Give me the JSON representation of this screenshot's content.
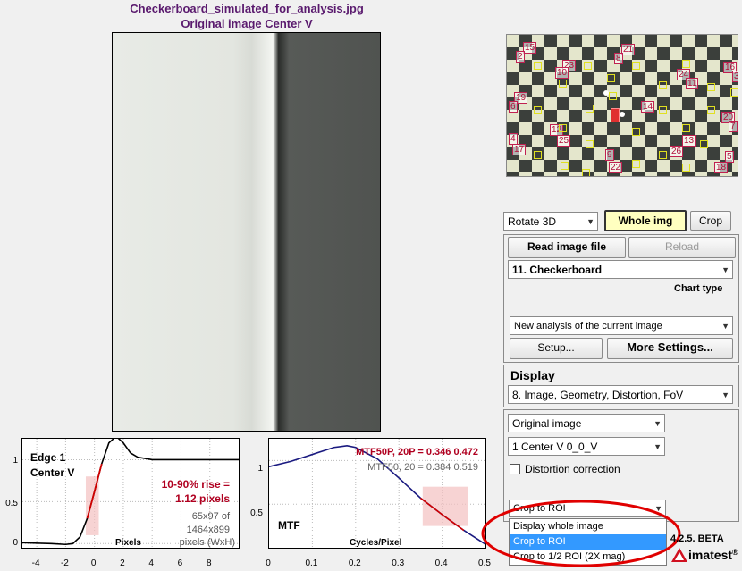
{
  "header": {
    "filename": "Checkerboard_simulated_for_analysis.jpg",
    "subtitle": "Original image   Center  V"
  },
  "edge_plot": {
    "title_line1": "Edge 1",
    "title_line2": "Center  V",
    "rise_label": "10-90% rise =",
    "rise_value": "1.12 pixels",
    "roi_size": "65x97 of",
    "image_size": "1464x899",
    "size_unit": "pixels (WxH)",
    "xlabel": "Pixels",
    "x_ticks": [
      "-4",
      "-2",
      "0",
      "2",
      "4",
      "6",
      "8"
    ],
    "y_ticks": [
      "0",
      "0.5",
      "1"
    ]
  },
  "mtf_plot": {
    "label": "MTF",
    "mtf50p": "MTF50P, 20P = 0.346  0.472",
    "mtf50": "MTF50, 20  =  0.384  0.519",
    "xlabel": "Cycles/Pixel",
    "x_ticks": [
      "0",
      "0.1",
      "0.2",
      "0.3",
      "0.4",
      "0.5"
    ],
    "y_ticks": [
      "0",
      "0.5",
      "1"
    ]
  },
  "chart_data": [
    {
      "type": "line",
      "title": "Edge 1 Center V",
      "xlabel": "Pixels",
      "ylabel": "",
      "xlim": [
        -5,
        10
      ],
      "ylim": [
        -0.05,
        1.25
      ],
      "series": [
        {
          "x": [
            -5,
            -3,
            -2,
            -1.5,
            -1,
            -0.5,
            0,
            0.5,
            1,
            1.5,
            2,
            2.5,
            3,
            4,
            5,
            6,
            8,
            10
          ],
          "y": [
            0.01,
            0.0,
            -0.01,
            0.0,
            0.08,
            0.3,
            0.62,
            0.95,
            1.2,
            1.28,
            1.2,
            1.08,
            1.03,
            1.0,
            1.0,
            1.0,
            1.0,
            1.0
          ]
        }
      ]
    },
    {
      "type": "line",
      "title": "MTF",
      "xlabel": "Cycles/Pixel",
      "ylabel": "",
      "xlim": [
        0,
        0.5
      ],
      "ylim": [
        0,
        1.25
      ],
      "series": [
        {
          "x": [
            0,
            0.05,
            0.1,
            0.15,
            0.18,
            0.2,
            0.25,
            0.3,
            0.35,
            0.4,
            0.45,
            0.5
          ],
          "y": [
            0.93,
            0.99,
            1.07,
            1.15,
            1.17,
            1.15,
            1.02,
            0.8,
            0.57,
            0.38,
            0.2,
            0.04
          ]
        }
      ]
    }
  ],
  "controls": {
    "rotate_label": "Rotate 3D",
    "whole_img_label": "Whole img",
    "crop_label": "Crop",
    "read_file_label": "Read image file",
    "reload_label": "Reload",
    "chart_select": "11. Checkerboard",
    "chart_type_label": "Chart type",
    "analysis_select": "New analysis of the current image",
    "setup_label": "Setup...",
    "more_settings_label": "More Settings...",
    "display_header": "Display",
    "display_select": "8.  Image, Geometry, Distortion, FoV",
    "image_select": "Original image",
    "roi_select": "1  Center  V      0_0_V",
    "distortion_label": "Distortion correction",
    "crop_select": "Crop to ROI",
    "crop_options": [
      "Display whole image",
      "Crop to ROI",
      "Crop to 1/2 ROI (2X mag)"
    ],
    "crop_selected_index": 1,
    "version": "4.2.5. BETA",
    "brand": "imatest",
    "registered": "®"
  },
  "thumbnail": {
    "roi_numbers": [
      "15",
      "2",
      "21",
      "8",
      "23",
      "10",
      "24",
      "11",
      "16",
      "3",
      "19",
      "6",
      "14",
      "12",
      "25",
      "20",
      "7",
      "4",
      "17",
      "13",
      "26",
      "9",
      "22",
      "5",
      "18"
    ]
  },
  "colors": {
    "accent_red": "#b00020",
    "title_purple": "#5a1a6e",
    "selection_blue": "#3399ff",
    "highlight_oval": "#e00000"
  }
}
